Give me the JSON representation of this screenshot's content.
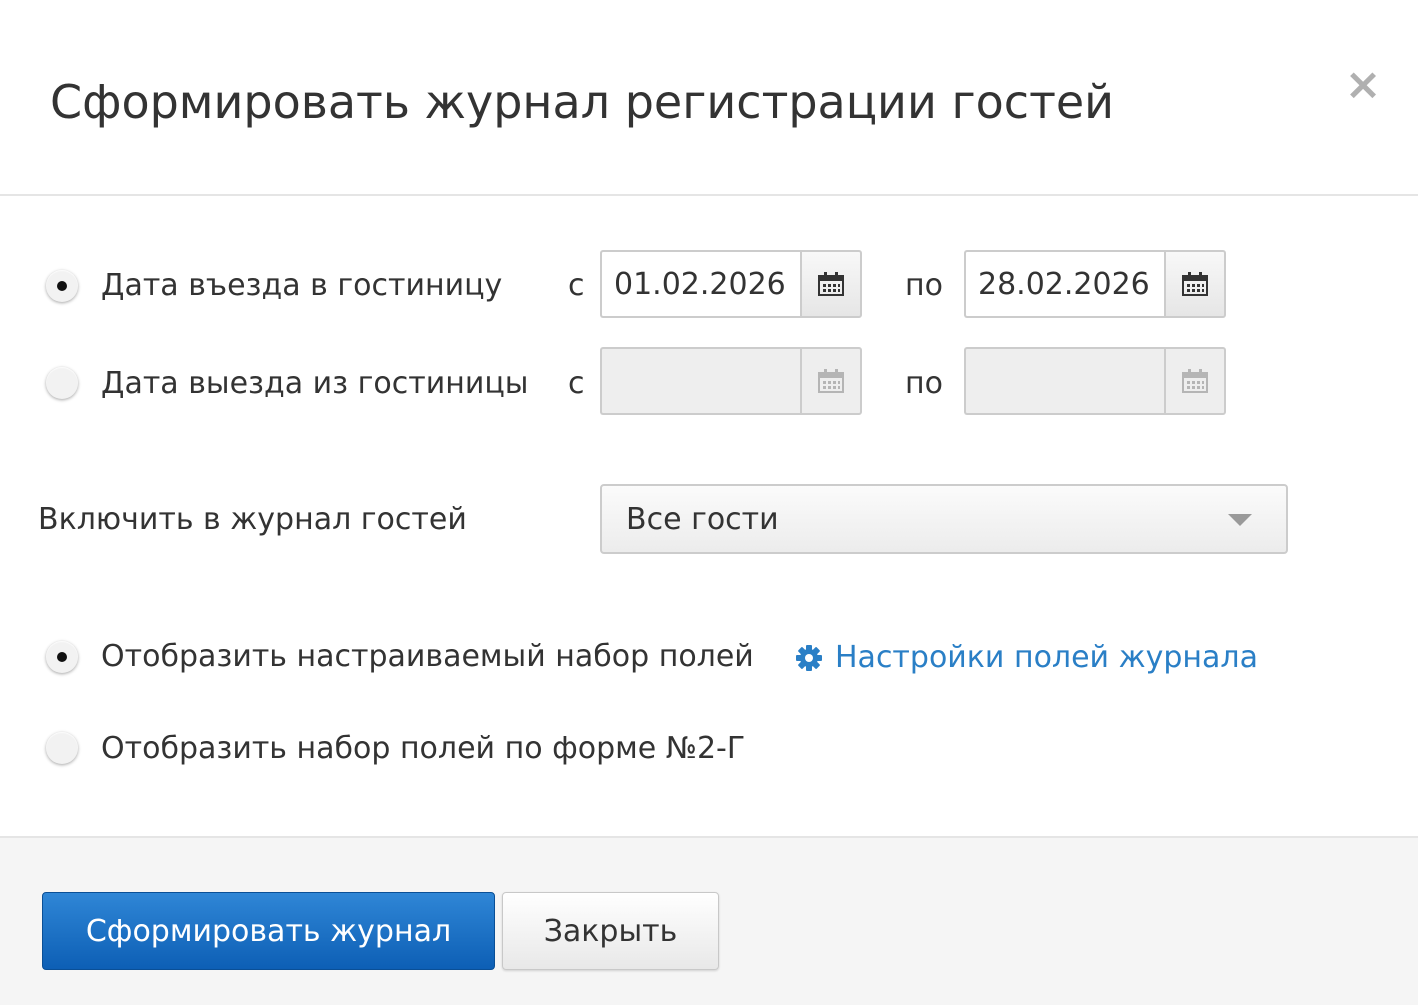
{
  "dialog": {
    "title": "Сформировать журнал регистрации гостей",
    "close_symbol": "×"
  },
  "date_filters": [
    {
      "label": "Дата въезда в гостиницу",
      "selected": true,
      "from_prefix": "с",
      "from_value": "01.02.2026",
      "to_prefix": "по",
      "to_value": "28.02.2026",
      "enabled": true
    },
    {
      "label": "Дата выезда из гостиницы",
      "selected": false,
      "from_prefix": "с",
      "from_value": "",
      "to_prefix": "по",
      "to_value": "",
      "enabled": false
    }
  ],
  "include": {
    "label": "Включить в журнал гостей",
    "selected_option": "Все гости"
  },
  "field_sets": [
    {
      "label": "Отобразить настраиваемый набор полей",
      "selected": true
    },
    {
      "label": "Отобразить набор полей по форме №2-Г",
      "selected": false
    }
  ],
  "settings_link": {
    "label": "Настройки полей журнала",
    "icon": "gear-icon"
  },
  "footer": {
    "primary_label": "Сформировать журнал",
    "close_label": "Закрыть"
  },
  "colors": {
    "primary": "#1a6fc4",
    "link": "#2a7fc6"
  }
}
